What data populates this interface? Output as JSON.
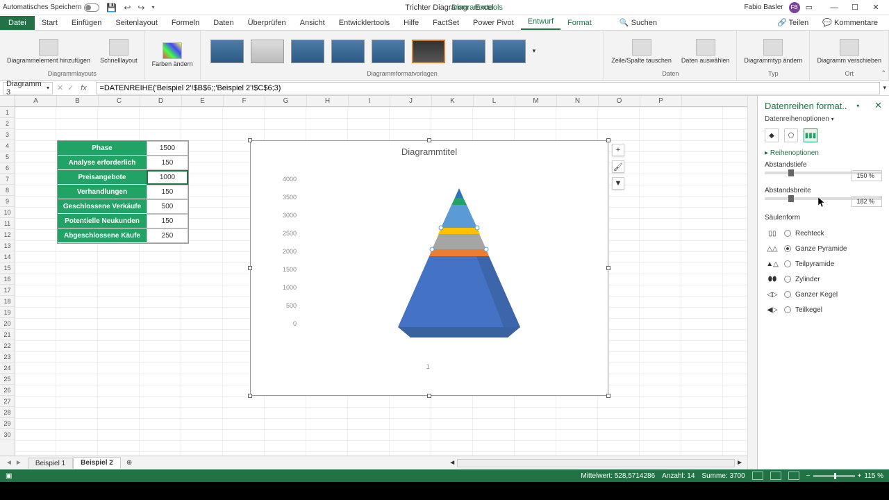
{
  "titlebar": {
    "autosave": "Automatisches Speichern",
    "doc_title": "Trichter Diagramm - Excel",
    "tools_title": "Diagrammtools",
    "user": "Fabio Basler",
    "user_initials": "FB"
  },
  "tabs": {
    "file": "Datei",
    "items": [
      "Start",
      "Einfügen",
      "Seitenlayout",
      "Formeln",
      "Daten",
      "Überprüfen",
      "Ansicht",
      "Entwicklertools",
      "Hilfe",
      "FactSet",
      "Power Pivot",
      "Entwurf",
      "Format"
    ],
    "active": "Entwurf",
    "search": "Suchen",
    "share": "Teilen",
    "comments": "Kommentare"
  },
  "ribbon": {
    "add_element": "Diagrammelement hinzufügen",
    "quick_layout": "Schnelllayout",
    "colors": "Farben ändern",
    "group_layouts": "Diagrammlayouts",
    "group_styles": "Diagrammformatvorlagen",
    "switch": "Zeile/Spalte tauschen",
    "select_data": "Daten auswählen",
    "group_data": "Daten",
    "change_type": "Diagrammtyp ändern",
    "group_type": "Typ",
    "move_chart": "Diagramm verschieben",
    "group_loc": "Ort"
  },
  "fbar": {
    "namebox": "Diagramm 3",
    "formula": "=DATENREIHE('Beispiel 2'!$B$6;;'Beispiel 2'!$C$6;3)"
  },
  "columns": [
    "A",
    "B",
    "C",
    "D",
    "E",
    "F",
    "G",
    "H",
    "I",
    "J",
    "K",
    "L",
    "M",
    "N",
    "O",
    "P"
  ],
  "rows_count": 30,
  "table": {
    "rows": [
      {
        "label": "Phase",
        "value": "1500"
      },
      {
        "label": "Analyse erforderlich",
        "value": "150"
      },
      {
        "label": "Preisangebote",
        "value": "1000"
      },
      {
        "label": "Verhandlungen",
        "value": "150"
      },
      {
        "label": "Geschlossene Verkäufe",
        "value": "500"
      },
      {
        "label": "Potentielle Neukunden",
        "value": "150"
      },
      {
        "label": "Abgeschlossene Käufe",
        "value": "250"
      }
    ],
    "selected_row": 2
  },
  "chart": {
    "title": "Diagrammtitel",
    "yticks": [
      "4000",
      "3500",
      "3000",
      "2500",
      "2000",
      "1500",
      "1000",
      "500",
      "0"
    ],
    "xcat": "1"
  },
  "chart_data": {
    "type": "bar",
    "title": "Diagrammtitel",
    "categories": [
      "1"
    ],
    "series": [
      {
        "name": "Abgeschlossene Käufe",
        "values": [
          250
        ],
        "color": "#2e75b6"
      },
      {
        "name": "Potentielle Neukunden",
        "values": [
          150
        ],
        "color": "#21a366"
      },
      {
        "name": "Geschlossene Verkäufe",
        "values": [
          500
        ],
        "color": "#5b9bd5"
      },
      {
        "name": "Verhandlungen",
        "values": [
          150
        ],
        "color": "#ffc000"
      },
      {
        "name": "Preisangebote",
        "values": [
          1000
        ],
        "color": "#a5a5a5"
      },
      {
        "name": "Analyse erforderlich",
        "values": [
          150
        ],
        "color": "#ed7d31"
      },
      {
        "name": "Phase",
        "values": [
          1500
        ],
        "color": "#4472c4"
      }
    ],
    "stacked_total": 3700,
    "ylim": [
      0,
      4000
    ],
    "shape": "Ganze Pyramide"
  },
  "pane": {
    "title": "Datenreihen format..",
    "sub": "Datenreihenoptionen",
    "section": "Reihenoptionen",
    "gap_depth_label": "Abstandstiefe",
    "gap_depth": "150 %",
    "gap_width_label": "Abstandsbreite",
    "gap_width": "182 %",
    "shape_label": "Säulenform",
    "shapes": [
      {
        "label": "Rechteck",
        "sel": false
      },
      {
        "label": "Ganze Pyramide",
        "sel": true
      },
      {
        "label": "Teilpyramide",
        "sel": false
      },
      {
        "label": "Zylinder",
        "sel": false
      },
      {
        "label": "Ganzer Kegel",
        "sel": false
      },
      {
        "label": "Teilkegel",
        "sel": false
      }
    ]
  },
  "sheets": {
    "tabs": [
      "Beispiel 1",
      "Beispiel 2"
    ],
    "active": "Beispiel 2"
  },
  "status": {
    "avg_label": "Mittelwert:",
    "avg": "528,5714286",
    "count_label": "Anzahl:",
    "count": "14",
    "sum_label": "Summe:",
    "sum": "3700",
    "zoom": "115 %"
  }
}
